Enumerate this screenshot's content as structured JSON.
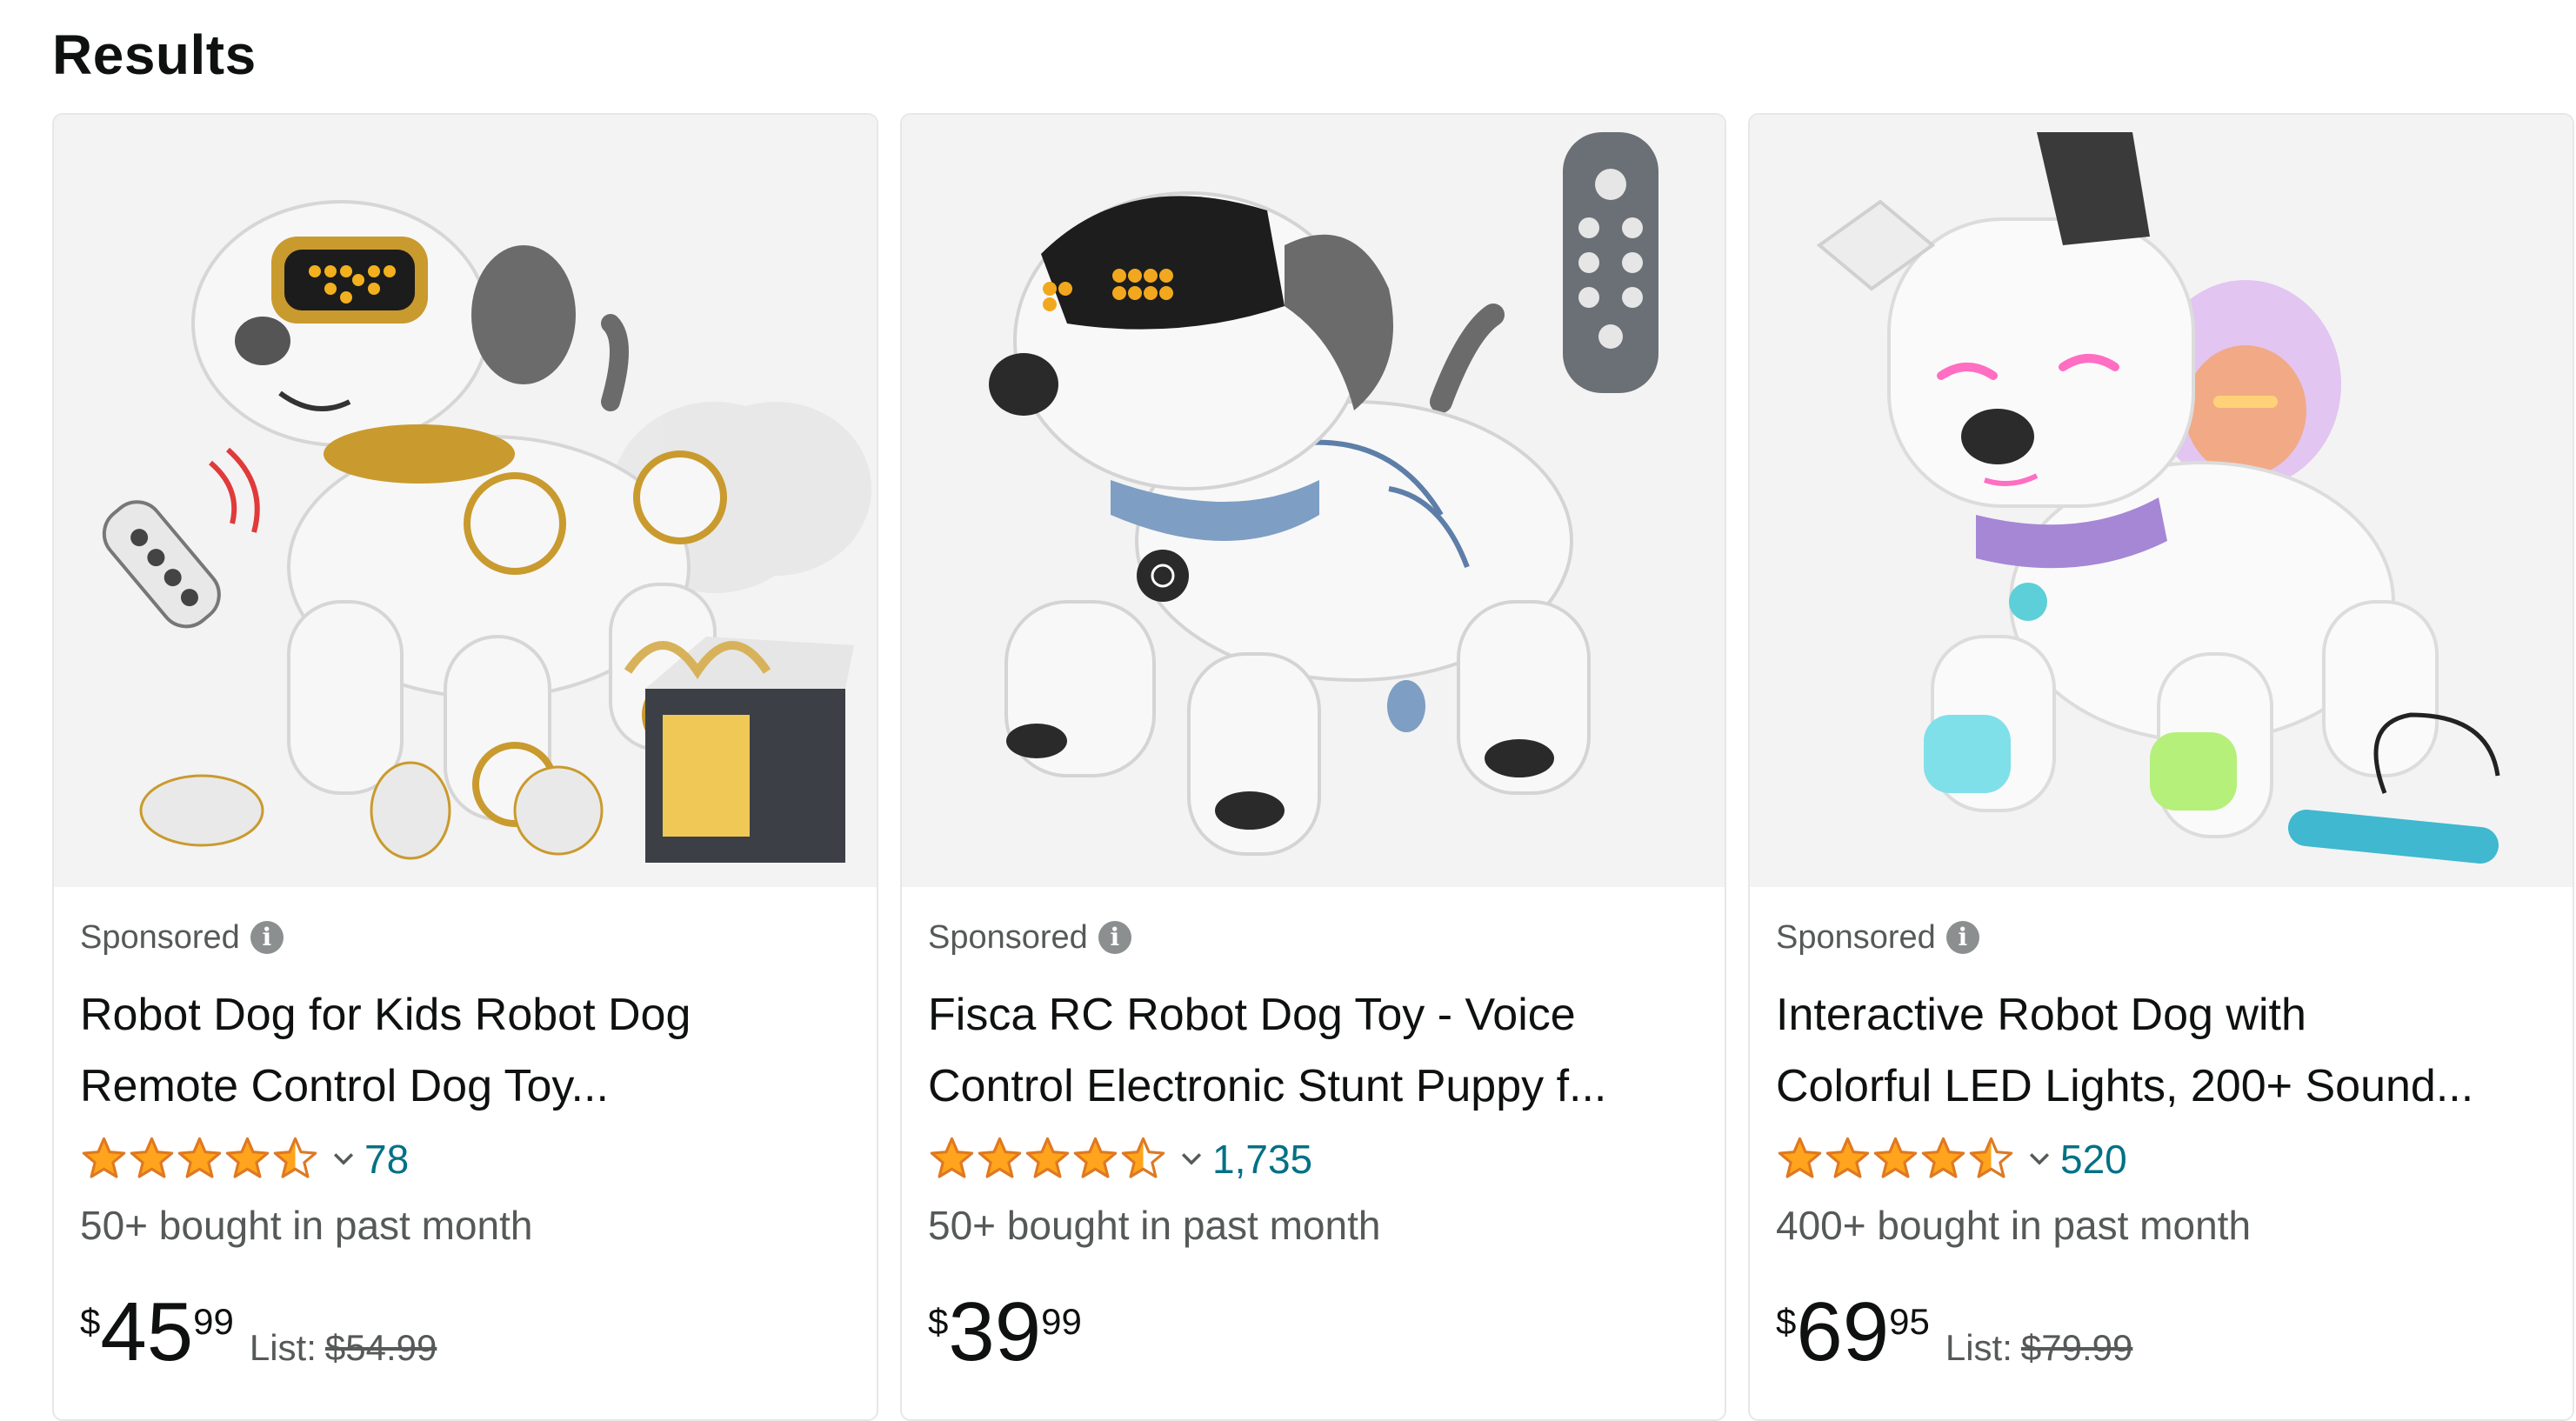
{
  "page": {
    "title": "Results"
  },
  "colors": {
    "star": "#ffa41c",
    "star_outline": "#de7921",
    "link": "#007185",
    "muted": "#565959",
    "text": "#0f1111"
  },
  "products": [
    {
      "sponsored": "Sponsored",
      "title_line1": "Robot Dog for Kids Robot Dog",
      "title_line2": "Remote Control Dog Toy...",
      "rating": 4.5,
      "reviews": "78",
      "bought": "50+ bought in past month",
      "price_symbol": "$",
      "price_whole": "45",
      "price_fraction": "99",
      "list_label": "List:",
      "list_price": "$54.99",
      "image_icon": "gold-white-robot-dog-with-remote-image"
    },
    {
      "sponsored": "Sponsored",
      "title_line1": "Fisca RC Robot Dog Toy - Voice",
      "title_line2": "Control Electronic Stunt Puppy f...",
      "rating": 4.5,
      "reviews": "1,735",
      "bought": "50+ bought in past month",
      "price_symbol": "$",
      "price_whole": "39",
      "price_fraction": "99",
      "list_label": "",
      "list_price": "",
      "image_icon": "white-blue-robot-dog-with-remote-image"
    },
    {
      "sponsored": "Sponsored",
      "title_line1": "Interactive Robot Dog with",
      "title_line2": "Colorful LED Lights, 200+ Sound...",
      "rating": 4.5,
      "reviews": "520",
      "bought": "400+ bought in past month",
      "price_symbol": "$",
      "price_whole": "69",
      "price_fraction": "95",
      "list_label": "List:",
      "list_price": "$79.99",
      "image_icon": "white-led-robot-dog-image"
    }
  ]
}
